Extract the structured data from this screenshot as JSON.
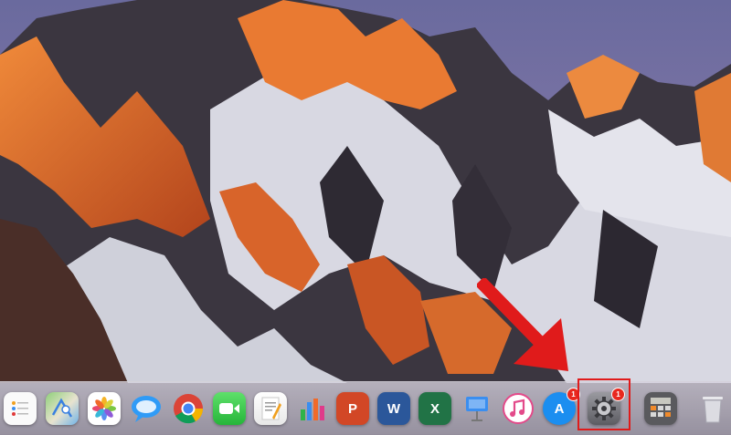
{
  "dock": {
    "items": [
      {
        "id": "reminders",
        "icon": "reminders-icon",
        "badge": ""
      },
      {
        "id": "maps",
        "icon": "maps-icon",
        "badge": ""
      },
      {
        "id": "photos",
        "icon": "photos-icon",
        "badge": ""
      },
      {
        "id": "messages",
        "icon": "messages-icon",
        "badge": ""
      },
      {
        "id": "chrome",
        "icon": "chrome-icon",
        "badge": ""
      },
      {
        "id": "facetime",
        "icon": "facetime-icon",
        "badge": ""
      },
      {
        "id": "pages",
        "icon": "pages-icon",
        "badge": ""
      },
      {
        "id": "numbers",
        "icon": "numbers-icon",
        "badge": ""
      },
      {
        "id": "powerpoint",
        "icon": "powerpoint-icon",
        "label": "P",
        "badge": ""
      },
      {
        "id": "word",
        "icon": "word-icon",
        "label": "W",
        "badge": ""
      },
      {
        "id": "excel",
        "icon": "excel-icon",
        "label": "X",
        "badge": ""
      },
      {
        "id": "keynote",
        "icon": "keynote-icon",
        "badge": ""
      },
      {
        "id": "itunes",
        "icon": "itunes-icon",
        "badge": ""
      },
      {
        "id": "app-store",
        "icon": "app-store-icon",
        "label": "A",
        "badge": "1"
      },
      {
        "id": "system-preferences",
        "icon": "gear-icon",
        "badge": "1"
      },
      {
        "id": "calculator",
        "icon": "calculator-icon",
        "badge": ""
      },
      {
        "id": "trash",
        "icon": "trash-icon",
        "badge": ""
      }
    ]
  },
  "annotation": {
    "arrow_color": "#e01b1b",
    "highlight_target": "system-preferences"
  },
  "colors": {
    "powerpoint": "#d24726",
    "word": "#2b579a",
    "excel": "#217346",
    "app_store": "#1b8ef0",
    "badge": "#e8281e",
    "facetime": "#2fcb3b",
    "messages": "#2f9bf7"
  }
}
